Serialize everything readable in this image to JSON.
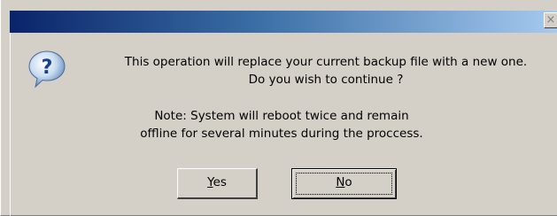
{
  "dialog": {
    "close_glyph": "×",
    "message_line1": "This operation will replace your current backup file with a new one.",
    "message_line2": "Do you wish to continue ?",
    "note_line1": "Note: System will reboot twice and remain",
    "note_line2": "offline for several minutes during the proccess.",
    "icon": "question-icon"
  },
  "buttons": {
    "yes_accel": "Y",
    "yes_rest": "es",
    "no_accel": "N",
    "no_rest": "o"
  },
  "colors": {
    "titlebar_start": "#0a246a",
    "titlebar_end": "#a6caf0",
    "face": "#d4d0c8"
  }
}
